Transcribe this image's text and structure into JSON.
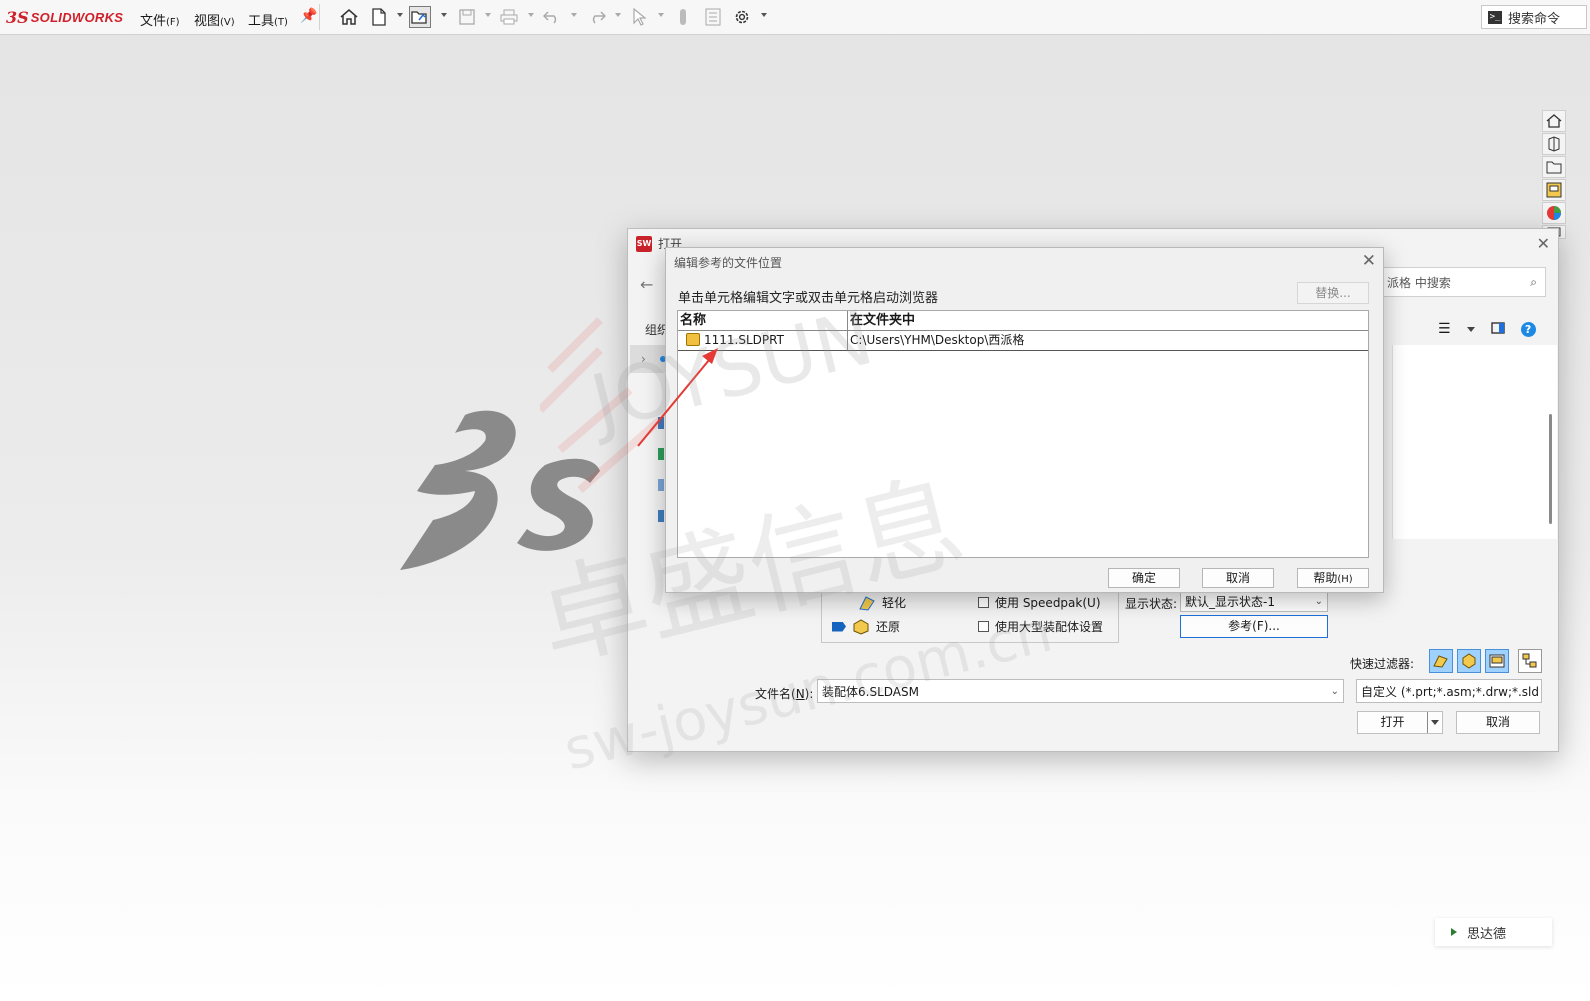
{
  "app": {
    "logo_prefix": "3S",
    "logo_text": "SOLIDWORKS",
    "menus": [
      {
        "label": "文件",
        "key": "(F)"
      },
      {
        "label": "视图",
        "key": "(V)"
      },
      {
        "label": "工具",
        "key": "(T)"
      }
    ],
    "search_command": "搜索命令"
  },
  "open_dialog": {
    "title": "打开",
    "search_placeholder": "派格 中搜索",
    "organize_label": "组织",
    "lightweight_label": "轻化",
    "resolved_label": "还原",
    "use_speedpak": "使用 Speedpak(U)",
    "use_large_assembly": "使用大型装配体设置",
    "display_state_label": "显示状态:",
    "display_state_value": "默认_显示状态-1",
    "references_button": "参考(F)...",
    "quick_filter_label": "快速过滤器:",
    "filename_label": "文件名(",
    "filename_label_key": "N",
    "filename_label_end": "):",
    "filename_value": "装配体6.SLDASM",
    "filetype_value": "自定义 (*.prt;*.asm;*.drw;*.sld",
    "open_button": "打开",
    "cancel_button": "取消"
  },
  "ref_dialog": {
    "title": "编辑参考的文件位置",
    "hint": "单击单元格编辑文字或双击单元格启动浏览器",
    "replace_button": "替换...",
    "columns": [
      "名称",
      "在文件夹中"
    ],
    "rows": [
      {
        "name": "1111.SLDPRT",
        "folder": "C:\\Users\\YHM\\Desktop\\西派格"
      }
    ],
    "ok_button": "确定",
    "cancel_button": "取消",
    "help_button": "帮助",
    "help_key": "(H)"
  },
  "watermark": {
    "line1": "JOYSUN",
    "line2": "卓盛信息",
    "line3": "sw-joysun.com.cn"
  },
  "toast": {
    "label": "思达德"
  },
  "colors": {
    "brand_red": "#d0202a",
    "accent_blue": "#1e6fd9",
    "arrow_red": "#e53935"
  }
}
